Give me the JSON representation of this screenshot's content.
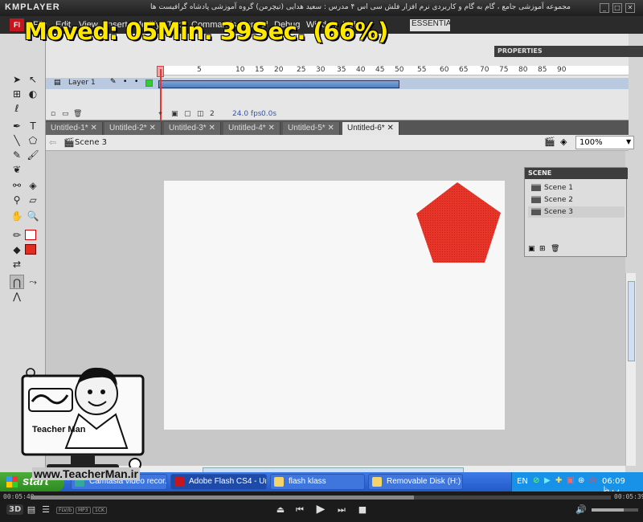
{
  "player": {
    "logo": "KMPLAYER",
    "caption": "مجموعه آموزشی جامع ، گام به گام و کاربردی نرم افزار فلش سی اس ۴ مدرس : سعید هدایی (تیچرمن) گروه آموزشی پادشاه گرافیست ها",
    "overlay": "Moved: 05Min. 39Sec. (66%)",
    "time_elapsed": "00:05:40",
    "time_total": "00:05:39",
    "progress_fraction": 0.66,
    "badges": [
      "FLV/b",
      "MP3",
      "1CK"
    ],
    "mode_badge": "3D"
  },
  "menu": {
    "items": [
      "File",
      "Edit",
      "View",
      "Insert",
      "Modify",
      "Text",
      "Commands",
      "Control",
      "Debug",
      "Window",
      "Help"
    ],
    "workspace": "ESSENTIALS"
  },
  "panels": {
    "properties_title": "PROPERTIES",
    "scene_title": "SCENE",
    "scenes": [
      "Scene 1",
      "Scene 2",
      "Scene 3"
    ]
  },
  "timeline": {
    "layer": "Layer 1",
    "frame_numbers": [
      "5",
      "10",
      "15",
      "20",
      "25",
      "30",
      "35",
      "40",
      "45",
      "50",
      "55",
      "60",
      "65",
      "70",
      "75",
      "80",
      "85",
      "90"
    ],
    "current_frame": "2",
    "fps": "24.0 fps",
    "seconds": "0.0s"
  },
  "documents": {
    "tabs": [
      "Untitled-1*",
      "Untitled-2*",
      "Untitled-3*",
      "Untitled-4*",
      "Untitled-5*",
      "Untitled-6*"
    ],
    "active": 5
  },
  "editbar": {
    "scene": "Scene 3",
    "zoom": "100%"
  },
  "stage": {
    "shape": "pentagon",
    "fill": "#e8352a"
  },
  "watermark": {
    "name": "Teacher Man",
    "url": "www.TeacherMan.ir"
  },
  "taskbar": {
    "start": "start",
    "tasks": [
      "Camtasia video recor...",
      "Adobe Flash CS4 - Un...",
      "flash klass",
      "Removable Disk (H:)"
    ],
    "lang": "EN",
    "clock": "06:09 ب.ظ"
  }
}
